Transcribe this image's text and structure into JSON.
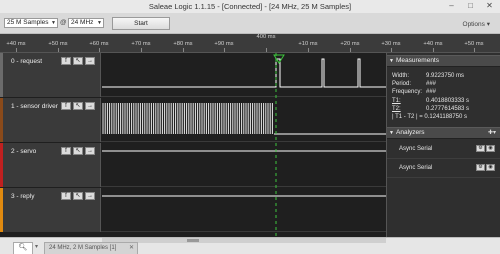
{
  "window": {
    "title": "Saleae Logic 1.1.15 - [Connected] - [24 MHz, 25 M Samples]",
    "minimize": "–",
    "maximize": "□",
    "close": "✕"
  },
  "toolbar": {
    "samples": "25 M Samples",
    "at": "@",
    "rate": "24 MHz",
    "start_label": "Start",
    "options_label": "Options ▾"
  },
  "ruler": {
    "center_label": "400 ms",
    "ticks": [
      "+40 ms",
      "+50 ms",
      "+60 ms",
      "+70 ms",
      "+80 ms",
      "+90 ms",
      "",
      "+10 ms",
      "+20 ms",
      "+30 ms",
      "+40 ms",
      "+50 ms"
    ]
  },
  "channels": [
    {
      "name": "0 - request",
      "color": "#6b6b6b"
    },
    {
      "name": "1 - sensor driver",
      "color": "#8a4a1a"
    },
    {
      "name": "2 - servo",
      "color": "#c02020"
    },
    {
      "name": "3 - reply",
      "color": "#e08a10"
    }
  ],
  "channel_icons": {
    "settings": "f",
    "arrow": "↖",
    "trigger": "→"
  },
  "measurements": {
    "header": "Measurements",
    "width_label": "Width:",
    "width_value": "9.9223750 ms",
    "period_label": "Period:",
    "period_value": "###",
    "freq_label": "Frequency:",
    "freq_value": "###",
    "t1_label": "T1:",
    "t1_value": "0.4018803333 s",
    "t2_label": "T2:",
    "t2_value": "0.2777614583 s",
    "diff_label": "| T1 - T2 | = 0.1241188750 s"
  },
  "analyzers": {
    "header": "Analyzers",
    "items": [
      "Async Serial",
      "Async Serial"
    ]
  },
  "bottom": {
    "search_icon": "search-icon",
    "capture_tab": "24 MHz, 2 M Samples [1]",
    "close": "✕",
    "tab_arrow": "▾"
  }
}
